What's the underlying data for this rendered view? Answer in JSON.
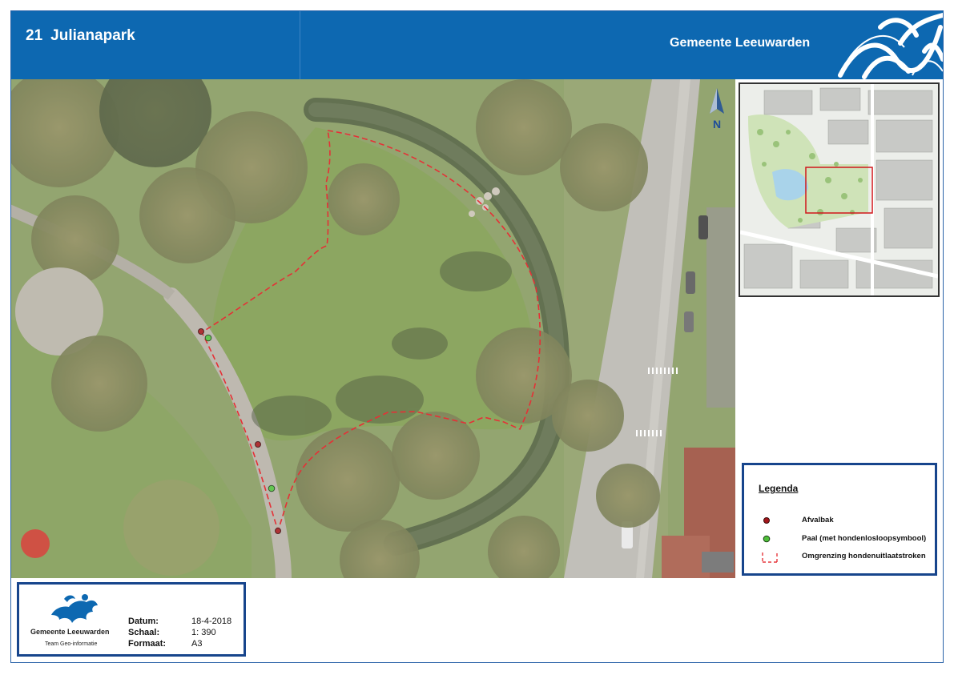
{
  "header": {
    "number": "21",
    "title": "Julianapark",
    "brand": "Gemeente Leeuwarden"
  },
  "map": {
    "north_label": "N"
  },
  "legend": {
    "title": "Legenda",
    "items": [
      {
        "label": "Afvalbak",
        "symbol": "red-dot",
        "color": "#a4161a"
      },
      {
        "label": "Paal (met hondenlosloopsymbool)",
        "symbol": "green-dot",
        "color": "#4fbf3a"
      },
      {
        "label": "Omgrenzing hondenuitlaatstroken",
        "symbol": "red-dashed-line",
        "color": "#e2141b"
      }
    ]
  },
  "info": {
    "logo_text": "Gemeente Leeuwarden",
    "logo_sub": "Team Geo-informatie",
    "rows": [
      {
        "label": "Datum:",
        "value": "18-4-2018"
      },
      {
        "label": "Schaal:",
        "value": "1: 390"
      },
      {
        "label": "Formaat:",
        "value": "A3"
      }
    ]
  },
  "colors": {
    "header_blue": "#0d68b1",
    "boundary_red": "#e2141b",
    "frame_blue": "#17458c"
  }
}
